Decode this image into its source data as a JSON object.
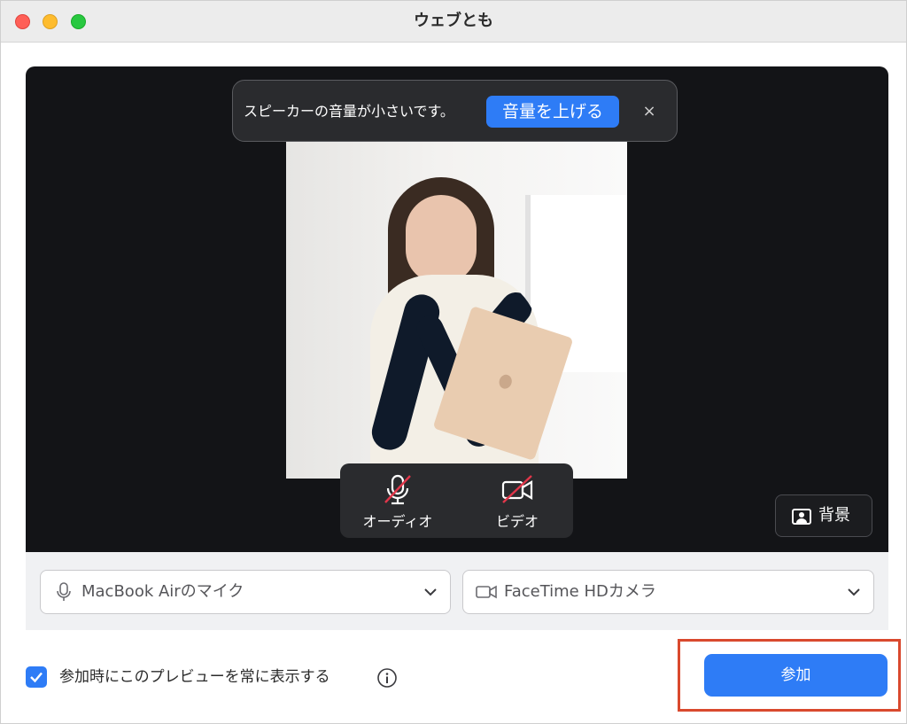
{
  "window": {
    "title": "ウェブとも"
  },
  "notification": {
    "message": "スピーカーの音量が小さいです。",
    "action_label": "音量を上げる",
    "close_glyph": "×"
  },
  "controls": {
    "audio_label": "オーディオ",
    "video_label": "ビデオ",
    "background_label": "背景"
  },
  "devices": {
    "microphone": "MacBook Airのマイク",
    "camera": "FaceTime HDカメラ"
  },
  "preview_option": {
    "label": "参加時にこのプレビューを常に表示する",
    "checked": true
  },
  "join_label": "参加",
  "icons": {
    "audio": "mic-muted-icon",
    "video": "camera-off-icon",
    "background": "background-image-icon",
    "mic_device": "microphone-icon",
    "cam_device": "camera-icon",
    "dropdown": "chevron-down-icon",
    "info": "info-icon"
  },
  "colors": {
    "accent": "#2e7cf6",
    "highlight": "#d9492e",
    "video_bg": "#131417",
    "mute_slash": "#e0364a"
  }
}
